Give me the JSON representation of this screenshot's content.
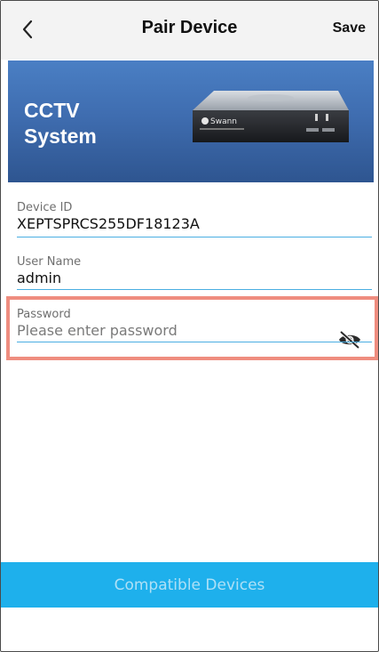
{
  "header": {
    "title": "Pair Device",
    "save_label": "Save",
    "back_icon": "chevron-left-icon"
  },
  "hero": {
    "title_line1": "CCTV",
    "title_line2": "System",
    "device_brand": "Swann",
    "background_color": "#3f6db0"
  },
  "form": {
    "device_id": {
      "label": "Device ID",
      "value": "XEPTSPRCS255DF18123A"
    },
    "user_name": {
      "label": "User Name",
      "value": "admin"
    },
    "password": {
      "label": "Password",
      "placeholder": "Please enter password",
      "toggle_icon": "eye-off-icon"
    }
  },
  "footer": {
    "compatible_label": "Compatible Devices",
    "button_color": "#1eb0ec"
  },
  "colors": {
    "accent_line": "#4aaee2",
    "highlight": "#ef8d7f"
  }
}
